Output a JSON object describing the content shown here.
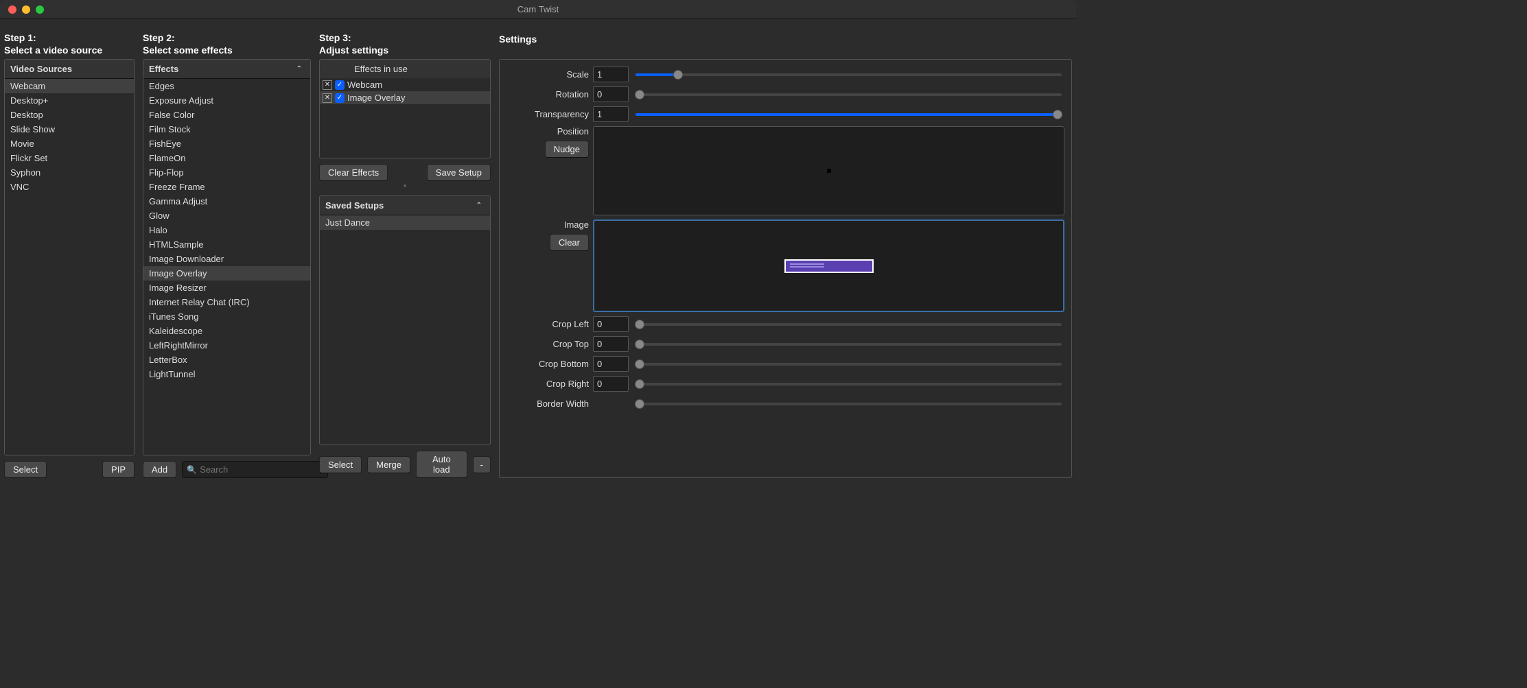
{
  "window": {
    "title": "Cam Twist"
  },
  "steps": {
    "s1_line1": "Step 1:",
    "s1_line2": "Select a video source",
    "s2_line1": "Step 2:",
    "s2_line2": "Select some effects",
    "s3_line1": "Step 3:",
    "s3_line2": "Adjust settings",
    "settings": "Settings"
  },
  "sources": {
    "header": "Video Sources",
    "items": [
      "Webcam",
      "Desktop+",
      "Desktop",
      "Slide Show",
      "Movie",
      "Flickr Set",
      "Syphon",
      "VNC"
    ],
    "selected": 0
  },
  "effects": {
    "header": "Effects",
    "items": [
      "Edges",
      "Exposure Adjust",
      "False Color",
      "Film Stock",
      "FishEye",
      "FlameOn",
      "Flip-Flop",
      "Freeze Frame",
      "Gamma Adjust",
      "Glow",
      "Halo",
      "HTMLSample",
      "Image Downloader",
      "Image Overlay",
      "Image Resizer",
      "Internet Relay Chat (IRC)",
      "iTunes Song",
      "Kaleidescope",
      "LeftRightMirror",
      "LetterBox",
      "LightTunnel"
    ],
    "selected": 13
  },
  "inuse": {
    "header": "Effects in use",
    "rows": [
      {
        "label": "Webcam",
        "checked": true
      },
      {
        "label": "Image Overlay",
        "checked": true
      }
    ],
    "selected": 1
  },
  "saved": {
    "header": "Saved Setups",
    "items": [
      "Just Dance"
    ],
    "selected": 0
  },
  "buttons": {
    "select1": "Select",
    "pip": "PIP",
    "add": "Add",
    "clear_effects": "Clear Effects",
    "save_setup": "Save Setup",
    "select3": "Select",
    "merge": "Merge",
    "autoload": "Auto load",
    "minus": "-",
    "nudge": "Nudge",
    "clear_img": "Clear"
  },
  "search": {
    "placeholder": "Search"
  },
  "settings_rows": {
    "scale": {
      "label": "Scale",
      "value": "1",
      "pct": 10
    },
    "rotation": {
      "label": "Rotation",
      "value": "0",
      "pct": 0
    },
    "transparency": {
      "label": "Transparency",
      "value": "1",
      "pct": 100
    },
    "position": {
      "label": "Position"
    },
    "image": {
      "label": "Image"
    },
    "crop_left": {
      "label": "Crop Left",
      "value": "0",
      "pct": 0
    },
    "crop_top": {
      "label": "Crop Top",
      "value": "0",
      "pct": 0
    },
    "crop_bottom": {
      "label": "Crop Bottom",
      "value": "0",
      "pct": 0
    },
    "crop_right": {
      "label": "Crop Right",
      "value": "0",
      "pct": 0
    },
    "border_width": {
      "label": "Border Width",
      "value": "0",
      "pct": 0
    }
  }
}
